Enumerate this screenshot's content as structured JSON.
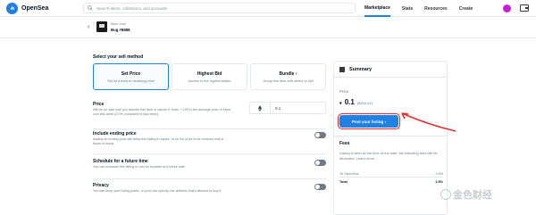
{
  "brand": {
    "name": "OpenSea",
    "color": "#2081e2"
  },
  "search": {
    "placeholder": "Search items, collections, and accounts"
  },
  "nav": {
    "links": [
      "Marketplace",
      "Stats",
      "Resources",
      "Create"
    ]
  },
  "item": {
    "collection": "More cool",
    "name": "Bug #8888"
  },
  "sell": {
    "heading": "Select your sell method",
    "methods": [
      {
        "title": "Set Price",
        "desc": "Sell at a fixed or declining price"
      },
      {
        "title": "Highest Bid",
        "desc": "Auction to the highest bidder"
      },
      {
        "title": "Bundle ›",
        "desc": "Group this item with others to sell"
      }
    ]
  },
  "price": {
    "title": "Price",
    "desc": "Will be on sale until you transfer this item or cancel it. Note: * 0.05 is the average price of More cool this week (0.0% compared to last week)",
    "currency_icon": "eth-icon",
    "value": "0.1"
  },
  "options": [
    {
      "title": "Include ending price",
      "desc": "Adding an ending price will allow this listing to expire, or for the price to be reduced until a buyer is found."
    },
    {
      "title": "Schedule for a future time",
      "desc": "You can schedule this listing to only be buyable at a future date"
    },
    {
      "title": "Privacy",
      "desc": "You can keep your listing public, or your can specify one address that's allowed to buy it."
    }
  ],
  "summary": {
    "title": "Summary",
    "price_label": "Price",
    "price_value": "0.1",
    "price_usd": "($303.42)",
    "post_button": "Post your listing  ›",
    "fees_label": "Fees",
    "fees_note": "Listing is free! At the time of the sale, the following fees will be deducted. Learn more",
    "fee_rows": [
      {
        "label": "To OpenSea",
        "value": "2.5%"
      },
      {
        "label": "Total",
        "value": "2.5%"
      }
    ]
  },
  "watermark": {
    "text": "金色财经"
  },
  "colors": {
    "accent": "#2081e2",
    "highlight": "#e5281f",
    "avatar": "#c51fd6"
  }
}
